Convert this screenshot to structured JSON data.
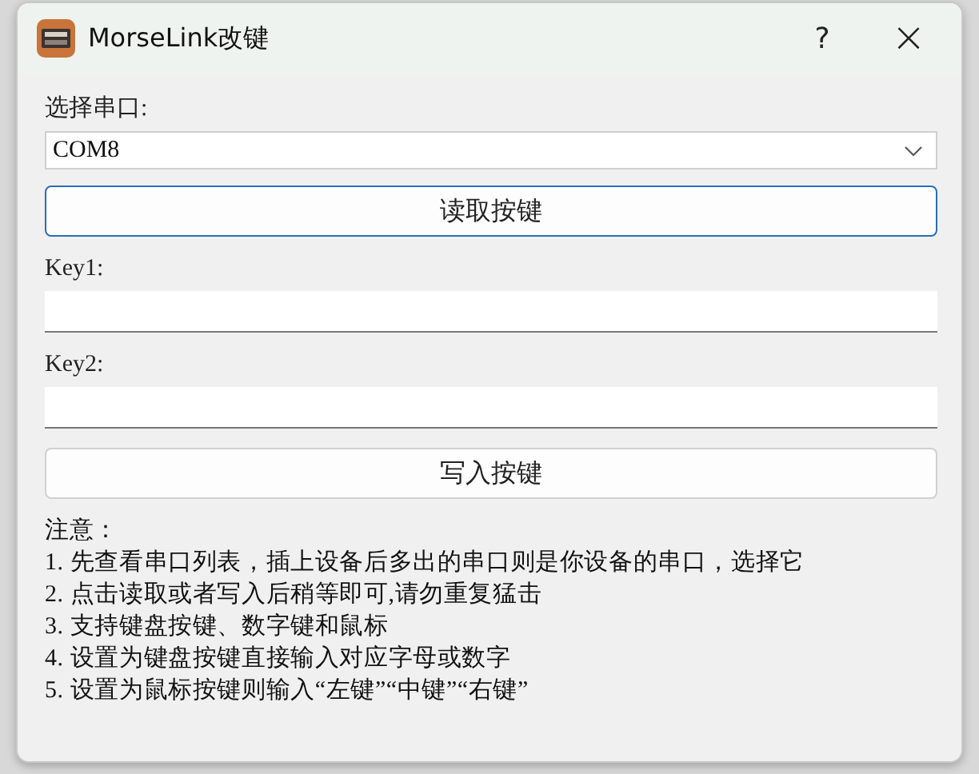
{
  "window": {
    "title": "MorseLink改键",
    "help": "?",
    "close": "×"
  },
  "port": {
    "label": "选择串口:",
    "value": "COM8"
  },
  "read_button": {
    "label": "读取按键",
    "focused": true
  },
  "keys": [
    {
      "label": "Key1:"
    },
    {
      "label": "Key2:"
    }
  ],
  "write_button": {
    "label": "写入按键",
    "focused": false
  },
  "notes": {
    "title": "注意：",
    "lines": [
      "1. 先查看串口列表，插上设备后多出的串口则是你设备的串口，选择它",
      "2. 点击读取或者写入后稍等即可,请勿重复猛击",
      "3. 支持键盘按键、数字键和鼠标",
      "4. 设置为键盘按键直接输入对应字母或数字",
      "5. 设置为鼠标按键则输入“左键”“中键”“右键”"
    ]
  }
}
